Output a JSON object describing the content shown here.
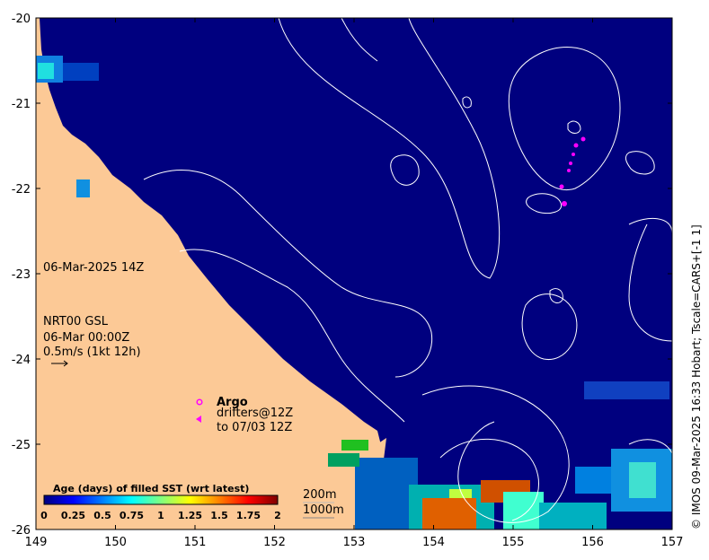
{
  "map": {
    "lon_ticks": [
      "149",
      "150",
      "151",
      "152",
      "153",
      "154",
      "155",
      "156",
      "157"
    ],
    "lat_ticks": [
      "-20",
      "-21",
      "-22",
      "-23",
      "-24",
      "-25",
      "-26"
    ],
    "extent": {
      "lon": [
        149,
        157
      ],
      "lat": [
        -26,
        -20
      ]
    },
    "colors": {
      "ocean": "#00007f",
      "land": "#fcc996",
      "contours": "#ffffff",
      "float_marker": "#ff00ff"
    }
  },
  "annotations": {
    "date": "06-Mar-2025 14Z",
    "product_line1": "NRT00 GSL",
    "product_line2": "06-Mar 00:00Z",
    "vector_scale": "0.5m/s (1kt 12h)"
  },
  "legend": {
    "argo_label": "Argo",
    "drifters_label": "drifters@12Z",
    "drifters_sub": "to 07/03 12Z"
  },
  "colorbar": {
    "title": "Age (days) of filled SST (wrt latest)",
    "ticks": [
      "0",
      "0.25",
      "0.5",
      "0.75",
      "1",
      "1.25",
      "1.5",
      "1.75",
      "2"
    ],
    "colors": [
      "#00007f",
      "#0000ff",
      "#0080ff",
      "#00ffff",
      "#80ff80",
      "#ffff00",
      "#ff8000",
      "#ff0000",
      "#7f0000"
    ]
  },
  "isobaths": {
    "label_200": "200m",
    "label_1000": "1000m"
  },
  "footer": "© IMOS 09-Mar-2025 16:33 Hobart; Tscale=CARS+[-1 1]"
}
